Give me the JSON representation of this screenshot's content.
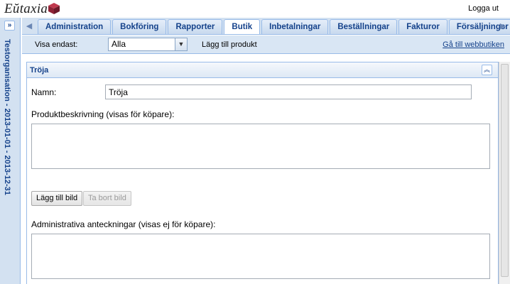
{
  "brand": {
    "logo_text": "Eŭtaxia"
  },
  "header": {
    "logout_label": "Logga ut"
  },
  "sidebar": {
    "collapsed_label": "Testorganisation - 2013-01-01 - 2013-12-31",
    "expand_glyph": "»"
  },
  "tabs": [
    {
      "label": "Administration",
      "active": false
    },
    {
      "label": "Bokföring",
      "active": false
    },
    {
      "label": "Rapporter",
      "active": false
    },
    {
      "label": "Butik",
      "active": true
    },
    {
      "label": "Inbetalningar",
      "active": false
    },
    {
      "label": "Beställningar",
      "active": false
    },
    {
      "label": "Fakturor",
      "active": false
    },
    {
      "label": "Försäljningsr",
      "active": false
    }
  ],
  "toolbar": {
    "filter_label": "Visa endast:",
    "filter_value": "Alla",
    "add_product_label": "Lägg till produkt",
    "webshop_link_label": "Gå till webbutiken"
  },
  "panel": {
    "title": "Tröja",
    "name_label": "Namn:",
    "name_value": "Tröja",
    "description_label": "Produktbeskrivning (visas för köpare):",
    "add_image_label": "Lägg till bild",
    "remove_image_label": "Ta bort bild",
    "admin_notes_label": "Administrativa anteckningar (visas ej för köpare):"
  },
  "colors": {
    "accent": "#15428b",
    "tab_bg": "#d3e1f1",
    "border": "#99bbe8"
  }
}
